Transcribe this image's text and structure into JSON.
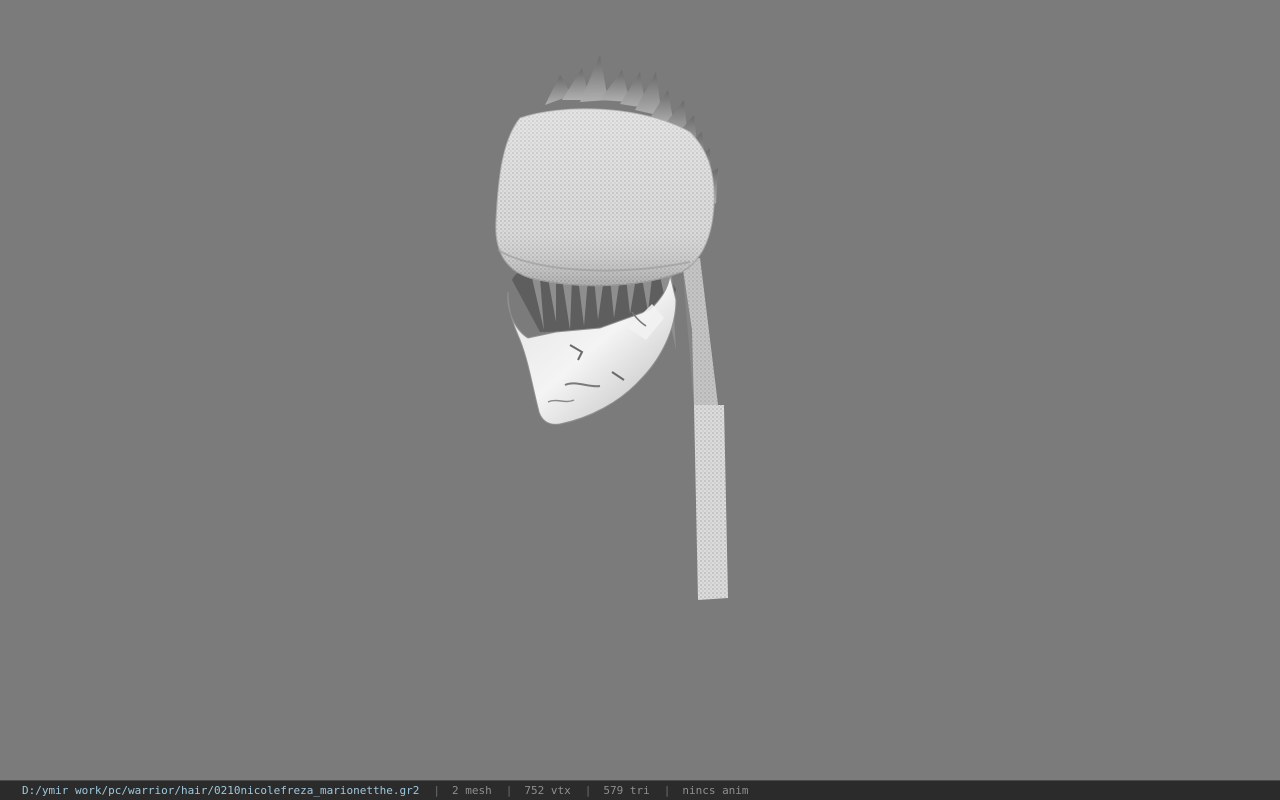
{
  "status_bar": {
    "file_path": "D:/ymir work/pc/warrior/hair/0210nicolefreza_marionetthe.gr2",
    "separator": "|",
    "mesh_count": "2 mesh",
    "vertex_count": "752 vtx",
    "triangle_count": "579 tri",
    "animation": "nincs anim"
  },
  "colors": {
    "viewport_background": "#7b7b7b",
    "status_bar_background": "#2b2b2b",
    "file_path_text": "#9ec7dc",
    "status_text": "#8e8e8e"
  }
}
